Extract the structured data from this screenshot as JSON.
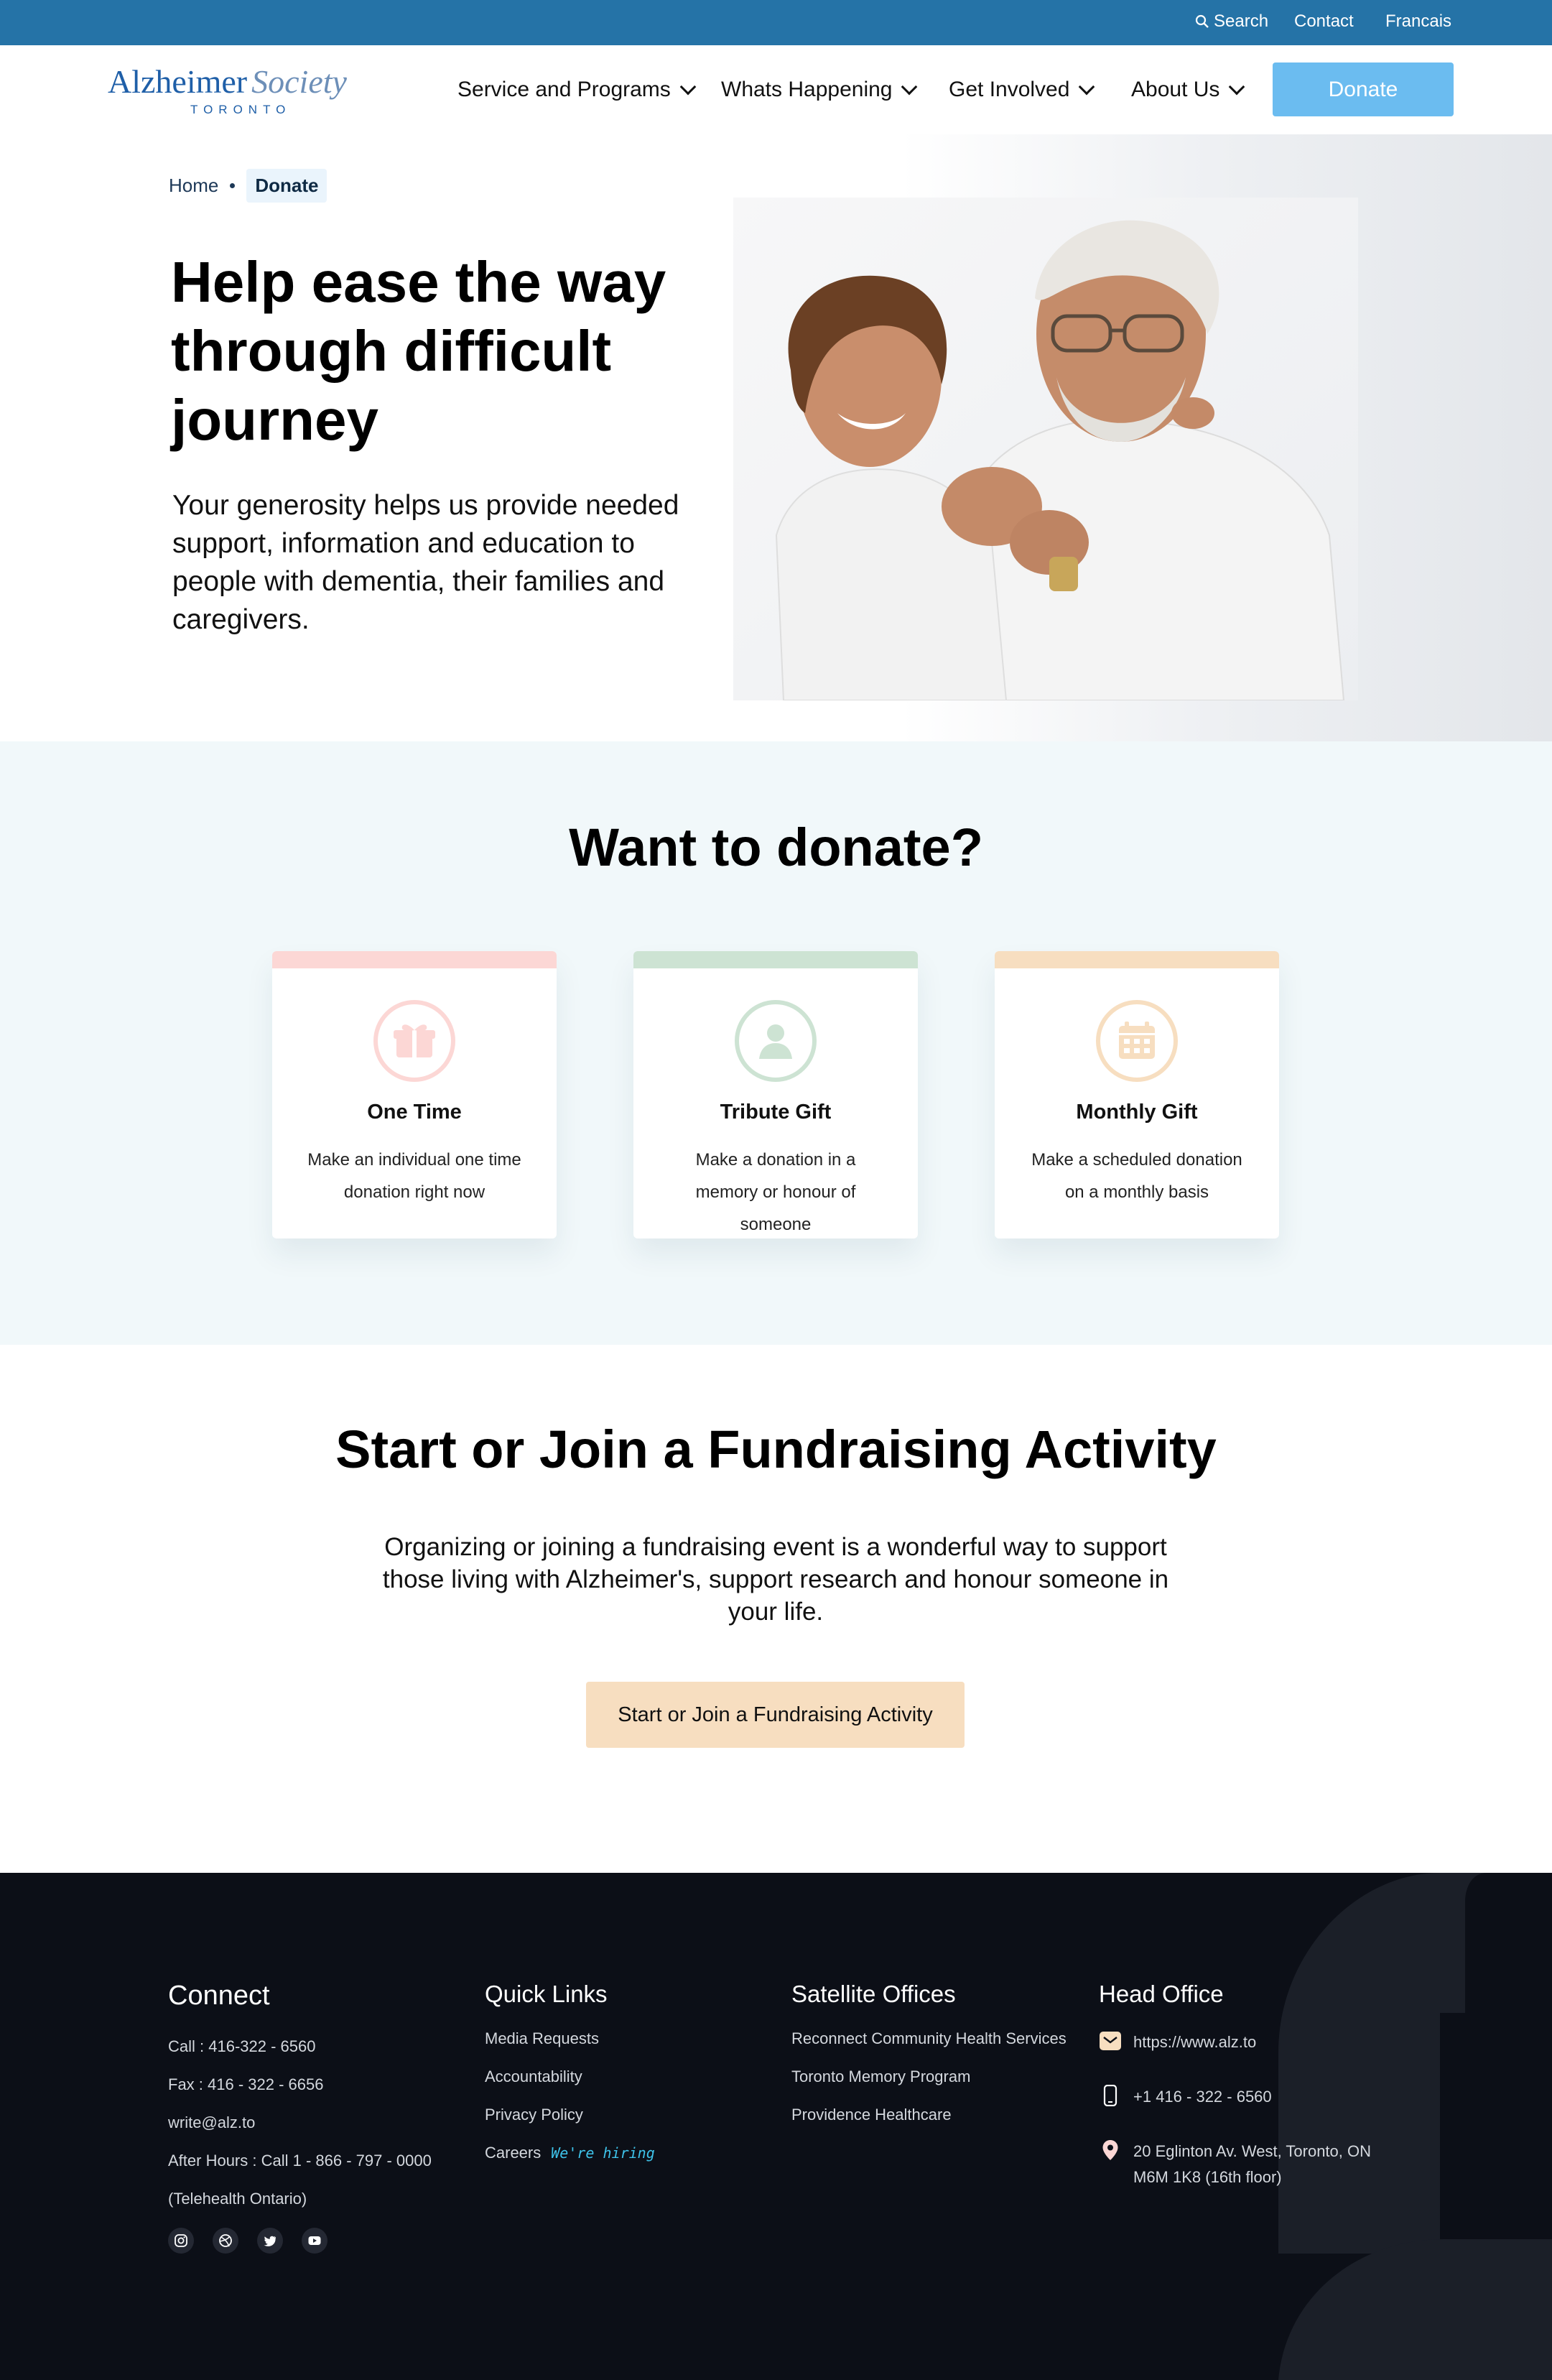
{
  "topbar": {
    "search": "Search",
    "contact": "Contact",
    "language": "Francais"
  },
  "logo": {
    "word1": "Alzheimer",
    "word2": "Society",
    "city": "TORONTO"
  },
  "nav": {
    "items": [
      {
        "label": "Service and Programs"
      },
      {
        "label": "Whats Happening"
      },
      {
        "label": "Get Involved"
      },
      {
        "label": "About Us"
      }
    ],
    "donate_label": "Donate"
  },
  "breadcrumb": {
    "home": "Home",
    "current": "Donate"
  },
  "hero": {
    "title": "Help ease the way through difficult journey",
    "text": "Your generosity helps us provide needed support, information and education to people with dementia, their families and caregivers."
  },
  "donate": {
    "title": "Want to donate?",
    "cards": [
      {
        "title": "One Time",
        "desc": "Make an individual one time donation right now",
        "icon": "gift-icon",
        "color": "#fcd7d5"
      },
      {
        "title": "Tribute Gift",
        "desc": "Make a donation in a memory or honour of someone",
        "icon": "person-icon",
        "color": "#cde3d3"
      },
      {
        "title": "Monthly Gift",
        "desc": "Make a scheduled donation on a monthly basis",
        "icon": "calendar-icon",
        "color": "#f7dec0"
      }
    ]
  },
  "fundraising": {
    "title": "Start or Join a Fundraising Activity",
    "text": "Organizing or joining a fundraising event is a wonderful way to support those living with Alzheimer's, support research and honour someone in your life.",
    "button": "Start or Join a Fundraising Activity"
  },
  "footer": {
    "connect": {
      "title": "Connect",
      "lines": [
        "Call : 416-322 - 6560",
        "Fax : 416 - 322 - 6656",
        "write@alz.to",
        "After Hours : Call 1 - 866 - 797 - 0000",
        "(Telehealth Ontario)"
      ],
      "socials": [
        "instagram-icon",
        "dribbble-icon",
        "twitter-icon",
        "youtube-icon"
      ]
    },
    "quick_links": {
      "title": "Quick Links",
      "items": [
        "Media Requests",
        "Accountability",
        "Privacy Policy",
        "Careers"
      ],
      "hiring": "We're hiring"
    },
    "satellite": {
      "title": "Satellite Offices",
      "items": [
        "Reconnect Community Health Services",
        "Toronto Memory Program",
        "Providence Healthcare"
      ]
    },
    "head_office": {
      "title": "Head Office",
      "website": "https://www.alz.to",
      "phone": "+1 416 - 322 - 6560",
      "address_line1": "20 Eglinton Av. West, Toronto, ON",
      "address_line2": "M6M 1K8 (16th floor)"
    }
  },
  "colors": {
    "topbar": "#2573a7",
    "donate_button": "#6bbcf0",
    "footer_bg": "#0c0f17",
    "section_bg": "#f1f8fa",
    "fund_button": "#f7dec0"
  }
}
